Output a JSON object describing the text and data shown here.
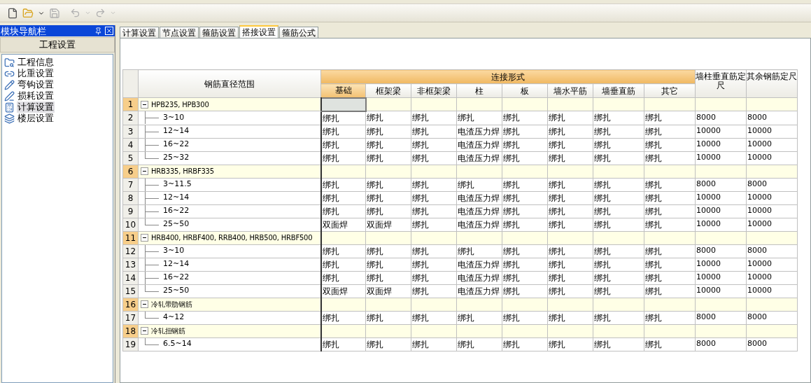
{
  "nav_panel": {
    "title": "模块导航栏",
    "section": "工程设置",
    "items": [
      {
        "label": "工程信息",
        "selected": false
      },
      {
        "label": "比重设置",
        "selected": false
      },
      {
        "label": "弯钩设置",
        "selected": false
      },
      {
        "label": "损耗设置",
        "selected": false
      },
      {
        "label": "计算设置",
        "selected": true
      },
      {
        "label": "楼层设置",
        "selected": false
      }
    ]
  },
  "tabs": [
    {
      "label": "计算设置",
      "selected": false
    },
    {
      "label": "节点设置",
      "selected": false
    },
    {
      "label": "箍筋设置",
      "selected": false
    },
    {
      "label": "搭接设置",
      "selected": true
    },
    {
      "label": "箍筋公式",
      "selected": false
    }
  ],
  "table": {
    "range_header": "钢筋直径范围",
    "group_header": "连接形式",
    "columns": [
      "基础",
      "框架梁",
      "非框架梁",
      "柱",
      "板",
      "墙水平筋",
      "墙垂直筋",
      "其它"
    ],
    "extra_columns": [
      "墙柱垂直筋定尺",
      "其余钢筋定尺"
    ],
    "groups": [
      {
        "number": "1",
        "label": "HPB235, HPB300",
        "expanded": true,
        "cell_selected": true,
        "children": [
          {
            "number": "2",
            "range": "3~10",
            "cells": [
              "绑扎",
              "绑扎",
              "绑扎",
              "绑扎",
              "绑扎",
              "绑扎",
              "绑扎",
              "绑扎",
              "8000",
              "8000"
            ]
          },
          {
            "number": "3",
            "range": "12~14",
            "cells": [
              "绑扎",
              "绑扎",
              "绑扎",
              "电渣压力焊",
              "绑扎",
              "绑扎",
              "绑扎",
              "绑扎",
              "10000",
              "10000"
            ]
          },
          {
            "number": "4",
            "range": "16~22",
            "cells": [
              "绑扎",
              "绑扎",
              "绑扎",
              "电渣压力焊",
              "绑扎",
              "绑扎",
              "绑扎",
              "绑扎",
              "10000",
              "10000"
            ]
          },
          {
            "number": "5",
            "range": "25~32",
            "cells": [
              "绑扎",
              "绑扎",
              "绑扎",
              "电渣压力焊",
              "绑扎",
              "绑扎",
              "绑扎",
              "绑扎",
              "10000",
              "10000"
            ]
          }
        ]
      },
      {
        "number": "6",
        "label": "HRB335, HRBF335",
        "expanded": true,
        "cell_selected": false,
        "children": [
          {
            "number": "7",
            "range": "3~11.5",
            "cells": [
              "绑扎",
              "绑扎",
              "绑扎",
              "绑扎",
              "绑扎",
              "绑扎",
              "绑扎",
              "绑扎",
              "8000",
              "8000"
            ]
          },
          {
            "number": "8",
            "range": "12~14",
            "cells": [
              "绑扎",
              "绑扎",
              "绑扎",
              "电渣压力焊",
              "绑扎",
              "绑扎",
              "绑扎",
              "绑扎",
              "10000",
              "10000"
            ]
          },
          {
            "number": "9",
            "range": "16~22",
            "cells": [
              "绑扎",
              "绑扎",
              "绑扎",
              "电渣压力焊",
              "绑扎",
              "绑扎",
              "绑扎",
              "绑扎",
              "10000",
              "10000"
            ]
          },
          {
            "number": "10",
            "range": "25~50",
            "cells": [
              "双面焊",
              "双面焊",
              "绑扎",
              "电渣压力焊",
              "绑扎",
              "绑扎",
              "绑扎",
              "绑扎",
              "10000",
              "10000"
            ]
          }
        ]
      },
      {
        "number": "11",
        "label": "HRB400, HRBF400, RRB400, HRB500, HRBF500",
        "expanded": true,
        "cell_selected": false,
        "children": [
          {
            "number": "12",
            "range": "3~10",
            "cells": [
              "绑扎",
              "绑扎",
              "绑扎",
              "绑扎",
              "绑扎",
              "绑扎",
              "绑扎",
              "绑扎",
              "8000",
              "8000"
            ]
          },
          {
            "number": "13",
            "range": "12~14",
            "cells": [
              "绑扎",
              "绑扎",
              "绑扎",
              "电渣压力焊",
              "绑扎",
              "绑扎",
              "绑扎",
              "绑扎",
              "10000",
              "10000"
            ]
          },
          {
            "number": "14",
            "range": "16~22",
            "cells": [
              "绑扎",
              "绑扎",
              "绑扎",
              "电渣压力焊",
              "绑扎",
              "绑扎",
              "绑扎",
              "绑扎",
              "10000",
              "10000"
            ]
          },
          {
            "number": "15",
            "range": "25~50",
            "cells": [
              "双面焊",
              "双面焊",
              "绑扎",
              "电渣压力焊",
              "绑扎",
              "绑扎",
              "绑扎",
              "绑扎",
              "10000",
              "10000"
            ]
          }
        ]
      },
      {
        "number": "16",
        "label": "冷轧带肋钢筋",
        "expanded": true,
        "cell_selected": false,
        "children": [
          {
            "number": "17",
            "range": "4~12",
            "cells": [
              "绑扎",
              "绑扎",
              "绑扎",
              "绑扎",
              "绑扎",
              "绑扎",
              "绑扎",
              "绑扎",
              "8000",
              "8000"
            ]
          }
        ]
      },
      {
        "number": "18",
        "label": "冷轧扭钢筋",
        "expanded": true,
        "cell_selected": false,
        "children": [
          {
            "number": "19",
            "range": "6.5~14",
            "cells": [
              "绑扎",
              "绑扎",
              "绑扎",
              "绑扎",
              "绑扎",
              "绑扎",
              "绑扎",
              "绑扎",
              "8000",
              "8000"
            ]
          }
        ]
      }
    ]
  }
}
